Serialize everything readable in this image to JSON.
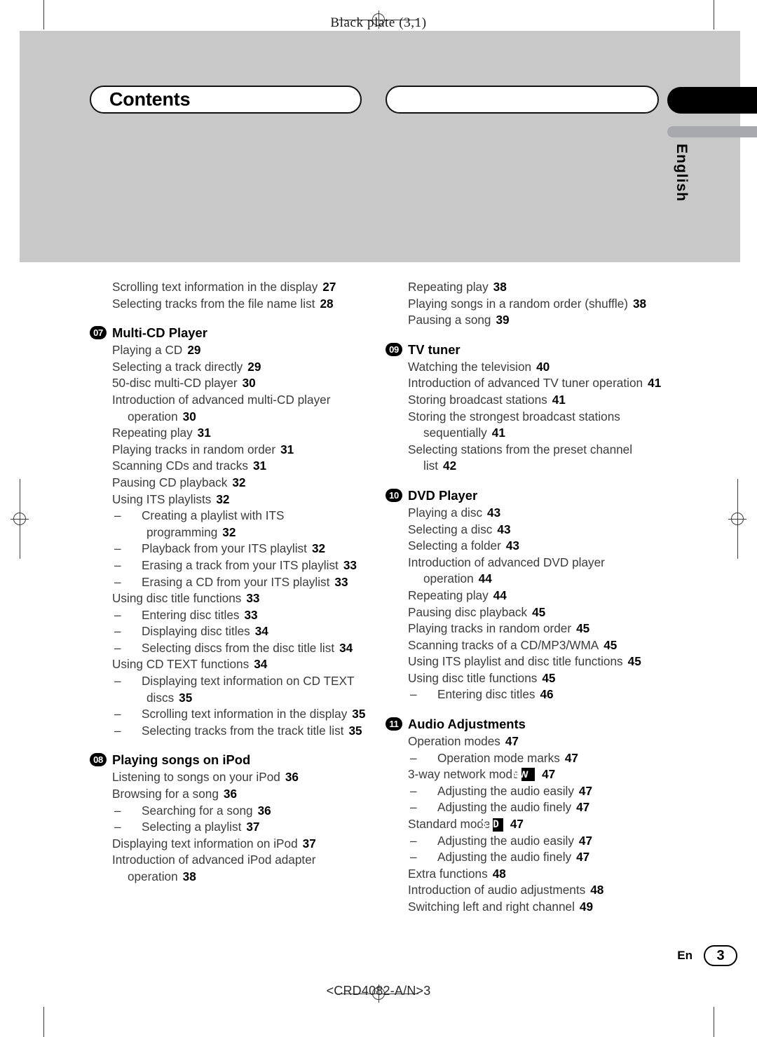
{
  "header": {
    "plate_label": "Black plate (3,1)"
  },
  "title_bar": {
    "contents_label": "Contents",
    "secondary_label": ""
  },
  "side_tab": {
    "language": "English"
  },
  "footer": {
    "locale_code": "En",
    "page_number": "3",
    "doc_code": "<CRD4082-A/N>3"
  },
  "toc": {
    "left_column": [
      {
        "level": 1,
        "text": "Scrolling text information in the display",
        "page": "27"
      },
      {
        "level": 1,
        "text": "Selecting tracks from the file name list",
        "page": "28"
      },
      {
        "type": "section",
        "number": "07",
        "title": "Multi-CD Player"
      },
      {
        "level": 1,
        "text": "Playing a CD",
        "page": "29"
      },
      {
        "level": 1,
        "text": "Selecting a track directly",
        "page": "29"
      },
      {
        "level": 1,
        "text": "50-disc multi-CD player",
        "page": "30"
      },
      {
        "level": 1,
        "text": "Introduction of advanced multi-CD player operation",
        "page": "30"
      },
      {
        "level": 1,
        "text": "Repeating play",
        "page": "31"
      },
      {
        "level": 1,
        "text": "Playing tracks in random order",
        "page": "31"
      },
      {
        "level": 1,
        "text": "Scanning CDs and tracks",
        "page": "31"
      },
      {
        "level": 1,
        "text": "Pausing CD playback",
        "page": "32"
      },
      {
        "level": 1,
        "text": "Using ITS playlists",
        "page": "32"
      },
      {
        "level": 2,
        "text": "Creating a playlist with ITS programming",
        "page": "32"
      },
      {
        "level": 2,
        "text": "Playback from your ITS playlist",
        "page": "32"
      },
      {
        "level": 2,
        "text": "Erasing a track from your ITS playlist",
        "page": "33"
      },
      {
        "level": 2,
        "text": "Erasing a CD from your ITS playlist",
        "page": "33"
      },
      {
        "level": 1,
        "text": "Using disc title functions",
        "page": "33"
      },
      {
        "level": 2,
        "text": "Entering disc titles",
        "page": "33"
      },
      {
        "level": 2,
        "text": "Displaying disc titles",
        "page": "34"
      },
      {
        "level": 2,
        "text": "Selecting discs from the disc title list",
        "page": "34"
      },
      {
        "level": 1,
        "text": "Using CD TEXT functions",
        "page": "34"
      },
      {
        "level": 2,
        "text": "Displaying text information on CD TEXT discs",
        "page": "35"
      },
      {
        "level": 2,
        "text": "Scrolling text information in the display",
        "page": "35"
      },
      {
        "level": 2,
        "text": "Selecting tracks from the track title list",
        "page": "35"
      },
      {
        "type": "section",
        "number": "08",
        "title": "Playing songs on iPod"
      },
      {
        "level": 1,
        "text": "Listening to songs on your iPod",
        "page": "36"
      },
      {
        "level": 1,
        "text": "Browsing for a song",
        "page": "36"
      },
      {
        "level": 2,
        "text": "Searching for a song",
        "page": "36"
      },
      {
        "level": 2,
        "text": "Selecting a playlist",
        "page": "37"
      },
      {
        "level": 1,
        "text": "Displaying text information on iPod",
        "page": "37"
      },
      {
        "level": 1,
        "text": "Introduction of advanced iPod adapter operation",
        "page": "38"
      }
    ],
    "right_column": [
      {
        "level": 1,
        "text": "Repeating play",
        "page": "38"
      },
      {
        "level": 1,
        "text": "Playing songs in a random order (shuffle)",
        "page": "38"
      },
      {
        "level": 1,
        "text": "Pausing a song",
        "page": "39"
      },
      {
        "type": "section",
        "number": "09",
        "title": "TV tuner"
      },
      {
        "level": 1,
        "text": "Watching the television",
        "page": "40"
      },
      {
        "level": 1,
        "text": "Introduction of advanced TV tuner operation",
        "page": "41"
      },
      {
        "level": 1,
        "text": "Storing broadcast stations",
        "page": "41"
      },
      {
        "level": 1,
        "text": "Storing the strongest broadcast stations sequentially",
        "page": "41"
      },
      {
        "level": 1,
        "text": "Selecting stations from the preset channel list",
        "page": "42"
      },
      {
        "type": "section",
        "number": "10",
        "title": "DVD Player"
      },
      {
        "level": 1,
        "text": "Playing a disc",
        "page": "43"
      },
      {
        "level": 1,
        "text": "Selecting a disc",
        "page": "43"
      },
      {
        "level": 1,
        "text": "Selecting a folder",
        "page": "43"
      },
      {
        "level": 1,
        "text": "Introduction of advanced DVD player operation",
        "page": "44"
      },
      {
        "level": 1,
        "text": "Repeating play",
        "page": "44"
      },
      {
        "level": 1,
        "text": "Pausing disc playback",
        "page": "45"
      },
      {
        "level": 1,
        "text": "Playing tracks in random order",
        "page": "45"
      },
      {
        "level": 1,
        "text": "Scanning tracks of a CD/MP3/WMA",
        "page": "45"
      },
      {
        "level": 1,
        "text": "Using ITS playlist and disc title functions",
        "page": "45"
      },
      {
        "level": 1,
        "text": "Using disc title functions",
        "page": "45"
      },
      {
        "level": 2,
        "text": "Entering disc titles",
        "page": "46"
      },
      {
        "type": "section",
        "number": "11",
        "title": "Audio Adjustments"
      },
      {
        "level": 1,
        "text": "Operation modes",
        "page": "47"
      },
      {
        "level": 2,
        "text": "Operation mode marks",
        "page": "47"
      },
      {
        "level": 1,
        "text": "3-way network mode",
        "mark": "NW",
        "mark_style": "plain",
        "page": "47"
      },
      {
        "level": 2,
        "text": "Adjusting the audio easily",
        "page": "47"
      },
      {
        "level": 2,
        "text": "Adjusting the audio finely",
        "page": "47"
      },
      {
        "level": 1,
        "text": "Standard mode",
        "mark": "STD",
        "mark_style": "lcd",
        "page": "47"
      },
      {
        "level": 2,
        "text": "Adjusting the audio easily",
        "page": "47"
      },
      {
        "level": 2,
        "text": "Adjusting the audio finely",
        "page": "47"
      },
      {
        "level": 1,
        "text": "Extra functions",
        "page": "48"
      },
      {
        "level": 1,
        "text": "Introduction of audio adjustments",
        "page": "48"
      },
      {
        "level": 1,
        "text": "Switching left and right channel",
        "page": "49"
      }
    ]
  },
  "colors": {
    "band_gray": "#c8c8c8",
    "tab_gray": "#a6a9ad",
    "ink_black": "#000000",
    "body_text": "#3c3c3c"
  }
}
